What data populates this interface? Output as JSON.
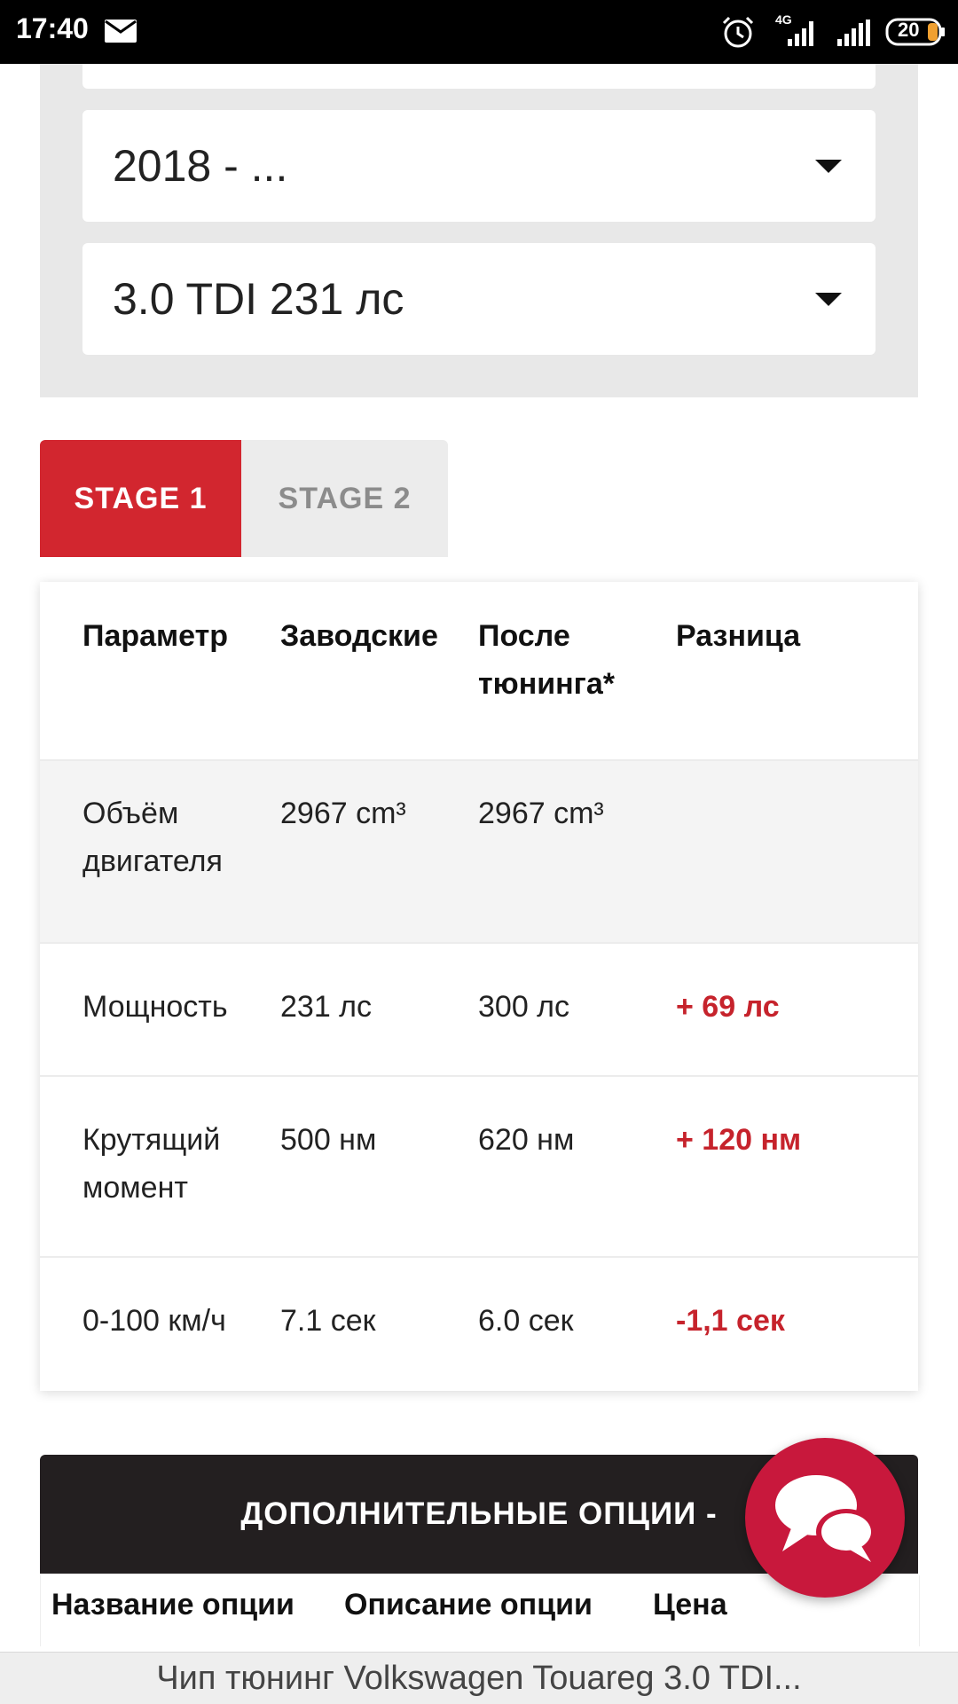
{
  "status_bar": {
    "time": "17:40",
    "network": "4G",
    "battery": "20",
    "icons": [
      "mail-icon",
      "alarm-icon",
      "signal-icon",
      "battery-icon"
    ]
  },
  "selectors": {
    "year": "2018 - ...",
    "engine": "3.0 TDI 231 лс"
  },
  "tabs": [
    {
      "label": "STAGE 1",
      "active": true
    },
    {
      "label": "STAGE 2",
      "active": false
    }
  ],
  "spec_table": {
    "headers": {
      "param": "Параметр",
      "stock": "Заводские",
      "tuned": "После тюнинга*",
      "diff": "Разница"
    },
    "rows": [
      {
        "param": "Объём двигателя",
        "stock": "2967 cm³",
        "tuned": "2967 cm³",
        "diff": ""
      },
      {
        "param": "Мощность",
        "stock": "231 лс",
        "tuned": "300 лс",
        "diff": "+ 69 лс"
      },
      {
        "param": "Крутящий момент",
        "stock": "500 нм",
        "tuned": "620 нм",
        "diff": "+ 120 нм"
      },
      {
        "param": "0-100 км/ч",
        "stock": "7.1 сек",
        "tuned": "6.0 сек",
        "diff": "-1,1 сек"
      }
    ]
  },
  "options": {
    "title": "ДОПОЛНИТЕЛЬНЫЕ ОПЦИИ -",
    "columns": [
      "Название опции",
      "Описание опции",
      "Цена"
    ]
  },
  "chat_button": {
    "icon": "chat-bubbles-icon"
  },
  "page_title": "Чип тюнинг Volkswagen Touareg 3.0 TDI...",
  "colors": {
    "accent": "#d2262f",
    "diff_text": "#c6232c",
    "chat": "#c8183c",
    "dark_header": "#231f20"
  }
}
